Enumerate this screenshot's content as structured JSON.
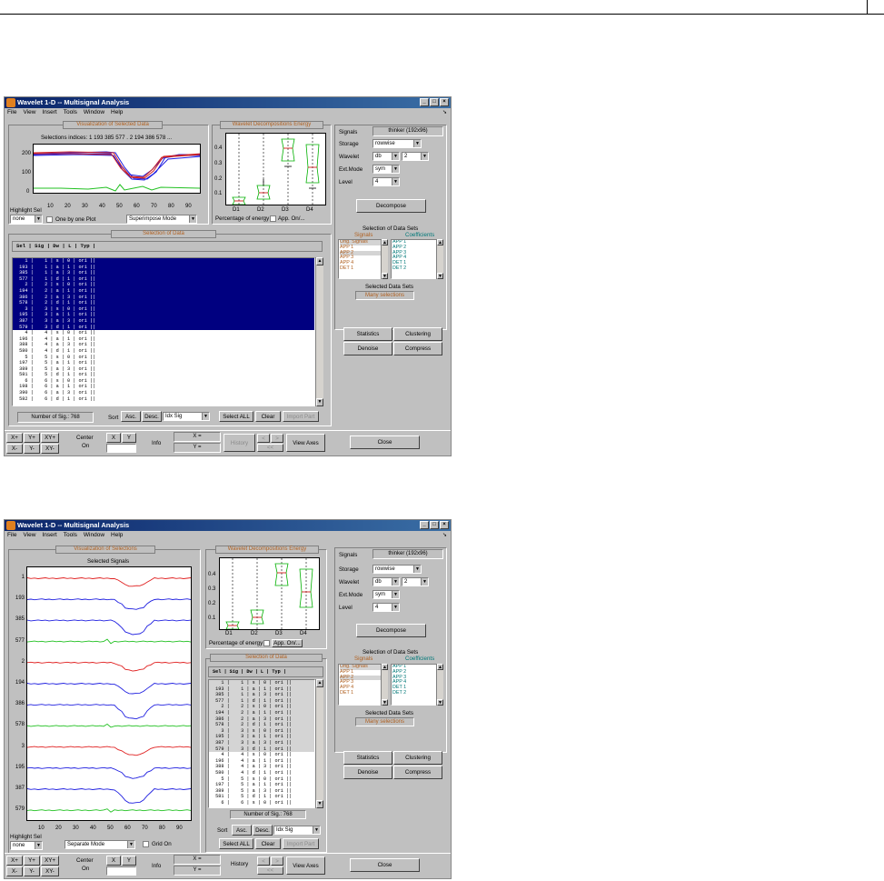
{
  "window1": {
    "title": "Wavelet 1-D -- Multisignal Analysis",
    "menu": [
      "File",
      "View",
      "Insert",
      "Tools",
      "Window",
      "Help"
    ],
    "vis_title": "Visualization of Selected Data",
    "selections_text": "Selections indices: 1 193 385 577 . 2 194 386 578 ...",
    "y_ticks": [
      "200",
      "100",
      "0"
    ],
    "x_ticks": [
      "10",
      "20",
      "30",
      "40",
      "50",
      "60",
      "70",
      "80",
      "90"
    ],
    "highlight_label": "Highlight Sel",
    "highlight_value": "none",
    "one_by_one": "One by one Plot",
    "mode_value": "Superimpose Mode",
    "energy_title": "Wavelet Decompositions Energy",
    "energy_y_ticks": [
      "0.4",
      "0.3",
      "0.2",
      "0.1"
    ],
    "energy_x_ticks": [
      "D1",
      "D2",
      "D3",
      "D4"
    ],
    "pct_energy": "Percentage of energy",
    "app_on": "App. On/...",
    "selection_title": "Selection of Data",
    "list_header": "Sel | Sig | Dw | L | Typ |",
    "num_sig": "Number of Sig.: 768",
    "sort": "Sort",
    "asc": "Asc.",
    "desc": "Desc.",
    "sort_value": "Idx Sig",
    "select_all": "Select ALL",
    "clear": "Clear",
    "import_part": "Import Part",
    "bottom": {
      "xplus": "X+",
      "yplus": "Y+",
      "xyplus": "XY+",
      "xminus": "X-",
      "yminus": "Y-",
      "xyminus": "XY-",
      "center": "Center",
      "on": "On",
      "x": "X",
      "y": "Y",
      "info": "Info",
      "xeq": "X =",
      "yeq": "Y =",
      "history": "History",
      "view_axes": "View Axes",
      "close": "Close"
    }
  },
  "window2": {
    "vis_title": "Visualization of Selections",
    "sel_signals": "Selected Signals",
    "row_labels": [
      "1",
      "193",
      "385",
      "577",
      "2",
      "194",
      "386",
      "578",
      "3",
      "195",
      "387",
      "579"
    ],
    "x_ticks": [
      "10",
      "20",
      "30",
      "40",
      "50",
      "60",
      "70",
      "80",
      "90"
    ],
    "mode_value": "Separate Mode",
    "grid_on": "Grid On",
    "history": "History"
  },
  "right_panel": {
    "signals_label": "Signals",
    "signals_value": "thinker (192x96)",
    "storage_label": "Storage",
    "storage_value": "rowwise",
    "wavelet_label": "Wavelet",
    "wavelet_value": "db",
    "wavelet_num": "2",
    "extmode_label": "Ext.Mode",
    "extmode_value": "sym",
    "level_label": "Level",
    "level_value": "4",
    "decompose": "Decompose",
    "sel_sets_title": "Selection of Data Sets",
    "signals_head": "Signals",
    "coeffs_head": "Coefficients",
    "signals_list": [
      "Orig. Signals",
      "APP 1",
      "APP 2",
      "APP 3",
      "APP 4",
      "DET 1"
    ],
    "coeffs_list": [
      "APP 1",
      "APP 2",
      "APP 3",
      "APP 4",
      "DET 1",
      "DET 2"
    ],
    "selected_sets": "Selected Data Sets",
    "many_sel": "Many selections",
    "statistics": "Statistics",
    "clustering": "Clustering",
    "denoise": "Denoise",
    "compress": "Compress"
  },
  "rows": [
    "   1 |    1 | s | 0 | ori ||",
    " 193 |    1 | a | 1 | ori ||",
    " 385 |    1 | a | 3 | ori ||",
    " 577 |    1 | d | 1 | ori ||",
    "   2 |    2 | s | 0 | ori ||",
    " 194 |    2 | a | 1 | ori ||",
    " 386 |    2 | a | 3 | ori ||",
    " 578 |    2 | d | 1 | ori ||",
    "   3 |    3 | s | 0 | ori ||",
    " 195 |    3 | a | 1 | ori ||",
    " 387 |    3 | a | 3 | ori ||",
    " 579 |    3 | d | 1 | ori ||",
    "   4 |    4 | s | 0 | ori ||",
    " 196 |    4 | a | 1 | ori ||",
    " 388 |    4 | a | 3 | ori ||",
    " 580 |    4 | d | 1 | ori ||",
    "   5 |    5 | s | 0 | ori ||",
    " 197 |    5 | a | 1 | ori ||",
    " 389 |    5 | a | 3 | ori ||",
    " 581 |    5 | d | 1 | ori ||",
    "   6 |    6 | s | 0 | ori ||",
    " 198 |    6 | a | 1 | ori ||",
    " 390 |    6 | a | 3 | ori ||",
    " 582 |    6 | d | 1 | ori ||"
  ]
}
